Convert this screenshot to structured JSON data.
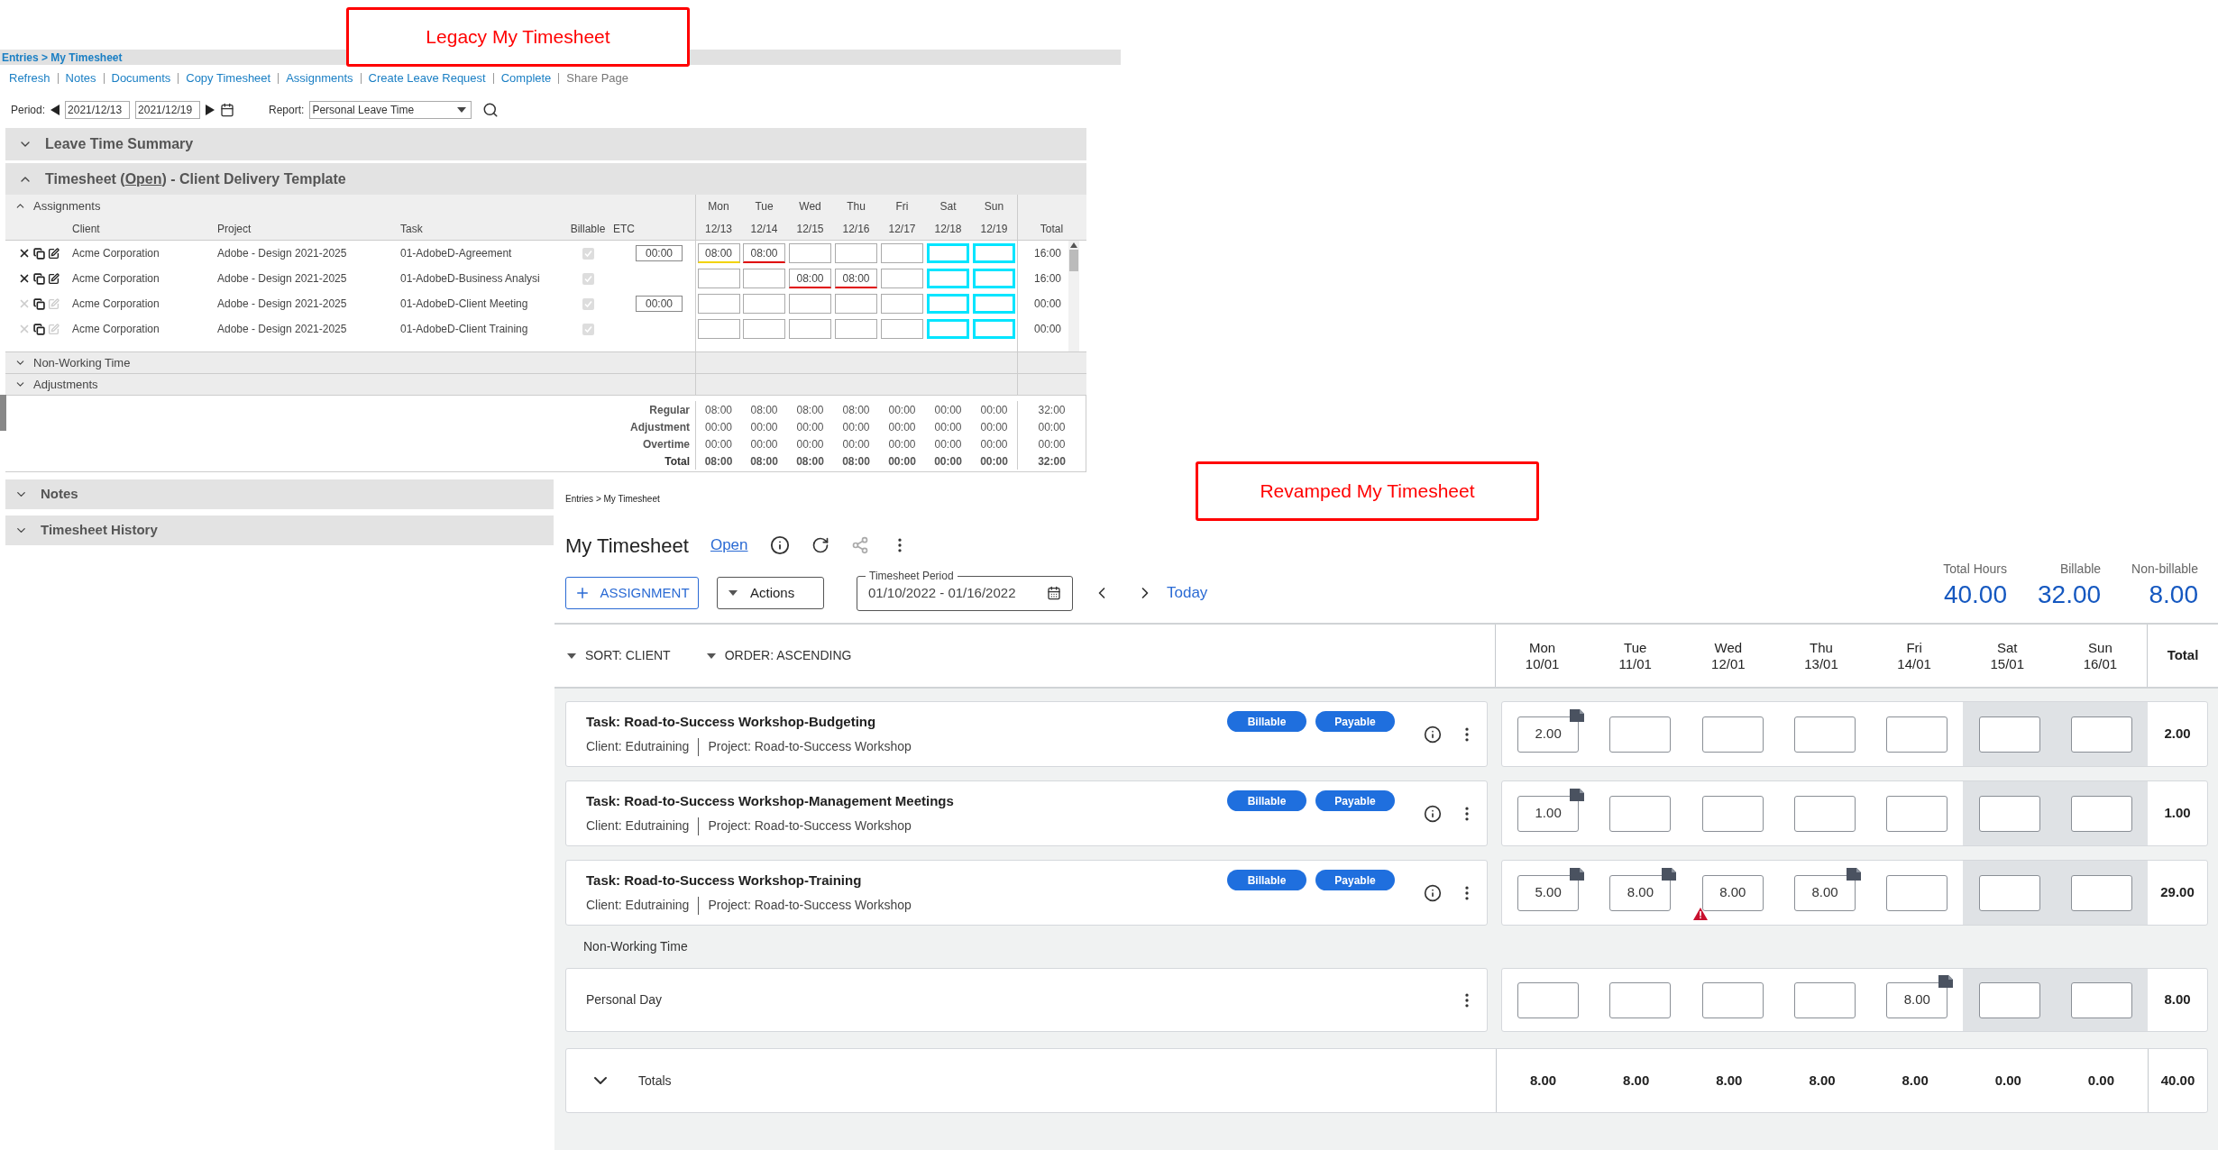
{
  "legacy": {
    "callout": "Legacy My Timesheet",
    "breadcrumb": "Entries > My Timesheet",
    "links": [
      {
        "label": "Refresh",
        "disabled": false
      },
      {
        "label": "Notes",
        "disabled": false
      },
      {
        "label": "Documents",
        "disabled": false
      },
      {
        "label": "Copy Timesheet",
        "disabled": false
      },
      {
        "label": "Assignments",
        "disabled": false
      },
      {
        "label": "Create Leave Request",
        "disabled": false
      },
      {
        "label": "Complete",
        "disabled": false
      },
      {
        "label": "Share Page",
        "disabled": true
      }
    ],
    "period": {
      "label": "Period:",
      "start": "2021/12/13",
      "end": "2021/12/19"
    },
    "report": {
      "label": "Report:",
      "value": "Personal Leave Time"
    },
    "summary_section": {
      "title": "Leave Time Summary",
      "expanded": false
    },
    "timesheet_section": {
      "title_before": "Timesheet (",
      "status": "Open",
      "title_after": ")  - Client Delivery Template",
      "expanded": true
    },
    "assignments": {
      "label": "Assignments",
      "expanded": true
    },
    "columns": [
      "Client",
      "Project",
      "Task",
      "Billable",
      "ETC"
    ],
    "days": [
      {
        "day": "Mon",
        "date": "12/13",
        "weekend": false
      },
      {
        "day": "Tue",
        "date": "12/14",
        "weekend": false
      },
      {
        "day": "Wed",
        "date": "12/15",
        "weekend": false
      },
      {
        "day": "Thu",
        "date": "12/16",
        "weekend": false
      },
      {
        "day": "Fri",
        "date": "12/17",
        "weekend": false
      },
      {
        "day": "Sat",
        "date": "12/18",
        "weekend": true
      },
      {
        "day": "Sun",
        "date": "12/19",
        "weekend": true
      }
    ],
    "total_label": "Total",
    "rows": [
      {
        "client": "Acme Corporation",
        "project": "Adobe - Design 2021-2025",
        "task": "01-AdobeD-Agreement",
        "billable": true,
        "etc": "00:00",
        "deletable": true,
        "cells": [
          {
            "value": "08:00",
            "warning": true,
            "error": false
          },
          {
            "value": "08:00",
            "warning": false,
            "error": true
          },
          {},
          {},
          {},
          {},
          {}
        ],
        "total": "16:00"
      },
      {
        "client": "Acme Corporation",
        "project": "Adobe - Design 2021-2025",
        "task": "01-AdobeD-Business Analysi",
        "billable": true,
        "deletable": true,
        "cells": [
          {},
          {},
          {
            "value": "08:00",
            "warning": false,
            "error": true
          },
          {
            "value": "08:00",
            "warning": false,
            "error": true
          },
          {},
          {},
          {}
        ],
        "total": "16:00"
      },
      {
        "client": "Acme Corporation",
        "project": "Adobe - Design 2021-2025",
        "task": "01-AdobeD-Client Meeting",
        "billable": true,
        "etc": "00:00",
        "deletable": false,
        "cells": [
          {},
          {},
          {},
          {},
          {},
          {},
          {}
        ],
        "total": "00:00"
      },
      {
        "client": "Acme Corporation",
        "project": "Adobe - Design 2021-2025",
        "task": "01-AdobeD-Client Training",
        "billable": true,
        "deletable": false,
        "cells": [
          {},
          {},
          {},
          {},
          {},
          {},
          {}
        ],
        "total": "00:00"
      }
    ],
    "groups": [
      {
        "title": "Non-Working Time",
        "expanded": false
      },
      {
        "title": "Adjustments",
        "expanded": false
      }
    ],
    "summary": [
      {
        "label": "Regular",
        "kind": "line",
        "values": [
          "08:00",
          "08:00",
          "08:00",
          "08:00",
          "00:00",
          "00:00",
          "00:00"
        ],
        "total": "32:00"
      },
      {
        "label": "Adjustment",
        "kind": "line",
        "values": [
          "00:00",
          "00:00",
          "00:00",
          "00:00",
          "00:00",
          "00:00",
          "00:00"
        ],
        "total": "00:00"
      },
      {
        "label": "Overtime",
        "kind": "line",
        "values": [
          "00:00",
          "00:00",
          "00:00",
          "00:00",
          "00:00",
          "00:00",
          "00:00"
        ],
        "total": "00:00"
      },
      {
        "label": "Total",
        "kind": "total",
        "values": [
          "08:00",
          "08:00",
          "08:00",
          "08:00",
          "00:00",
          "00:00",
          "00:00"
        ],
        "total": "32:00"
      }
    ],
    "bottom_sections": [
      {
        "title": "Notes",
        "expanded": false
      },
      {
        "title": "Timesheet History",
        "expanded": false
      }
    ]
  },
  "revamped": {
    "callout": "Revamped My Timesheet",
    "breadcrumb": "Entries > My Timesheet",
    "title": "My Timesheet",
    "status": "Open",
    "add_button": "ASSIGNMENT",
    "actions_button": "Actions",
    "period": {
      "label": "Timesheet Period",
      "value": "01/10/2022 - 01/16/2022"
    },
    "today": "Today",
    "stats": [
      {
        "label": "Total Hours",
        "value": "40.00"
      },
      {
        "label": "Billable",
        "value": "32.00"
      },
      {
        "label": "Non-billable",
        "value": "8.00"
      }
    ],
    "sort": "SORT: CLIENT",
    "order": "ORDER: ASCENDING",
    "days": [
      {
        "day": "Mon",
        "date": "10/01",
        "weekend": false
      },
      {
        "day": "Tue",
        "date": "11/01",
        "weekend": false
      },
      {
        "day": "Wed",
        "date": "12/01",
        "weekend": false
      },
      {
        "day": "Thu",
        "date": "13/01",
        "weekend": false
      },
      {
        "day": "Fri",
        "date": "14/01",
        "weekend": false
      },
      {
        "day": "Sat",
        "date": "15/01",
        "weekend": true
      },
      {
        "day": "Sun",
        "date": "16/01",
        "weekend": true
      }
    ],
    "total_label": "Total",
    "assignments": [
      {
        "task": "Task: Road-to-Success Workshop-Budgeting",
        "client": "Client: Edutraining",
        "project": "Project: Road-to-Success Workshop",
        "badges": [
          "Billable",
          "Payable"
        ],
        "cells": [
          {
            "value": "2.00",
            "note": true
          },
          {},
          {},
          {},
          {},
          {},
          {}
        ],
        "total": "2.00"
      },
      {
        "task": "Task: Road-to-Success Workshop-Management Meetings",
        "client": "Client: Edutraining",
        "project": "Project: Road-to-Success Workshop",
        "badges": [
          "Billable",
          "Payable"
        ],
        "cells": [
          {
            "value": "1.00",
            "note": true
          },
          {},
          {},
          {},
          {},
          {},
          {}
        ],
        "total": "1.00"
      },
      {
        "task": "Task: Road-to-Success Workshop-Training",
        "client": "Client: Edutraining",
        "project": "Project: Road-to-Success Workshop",
        "badges": [
          "Billable",
          "Payable"
        ],
        "cells": [
          {
            "value": "5.00",
            "note": true
          },
          {
            "value": "8.00",
            "note": true
          },
          {
            "value": "8.00",
            "warning": true
          },
          {
            "value": "8.00",
            "note": true
          },
          {},
          {},
          {}
        ],
        "total": "29.00"
      }
    ],
    "non_working": {
      "label": "Non-Working Time",
      "rows": [
        {
          "name": "Personal Day",
          "cells": [
            {},
            {},
            {},
            {},
            {
              "value": "8.00",
              "note": true
            },
            {},
            {}
          ],
          "total": "8.00"
        }
      ]
    },
    "totals": {
      "label": "Totals",
      "expanded": false,
      "values": [
        "8.00",
        "8.00",
        "8.00",
        "8.00",
        "8.00",
        "0.00",
        "0.00"
      ],
      "total": "40.00"
    }
  }
}
